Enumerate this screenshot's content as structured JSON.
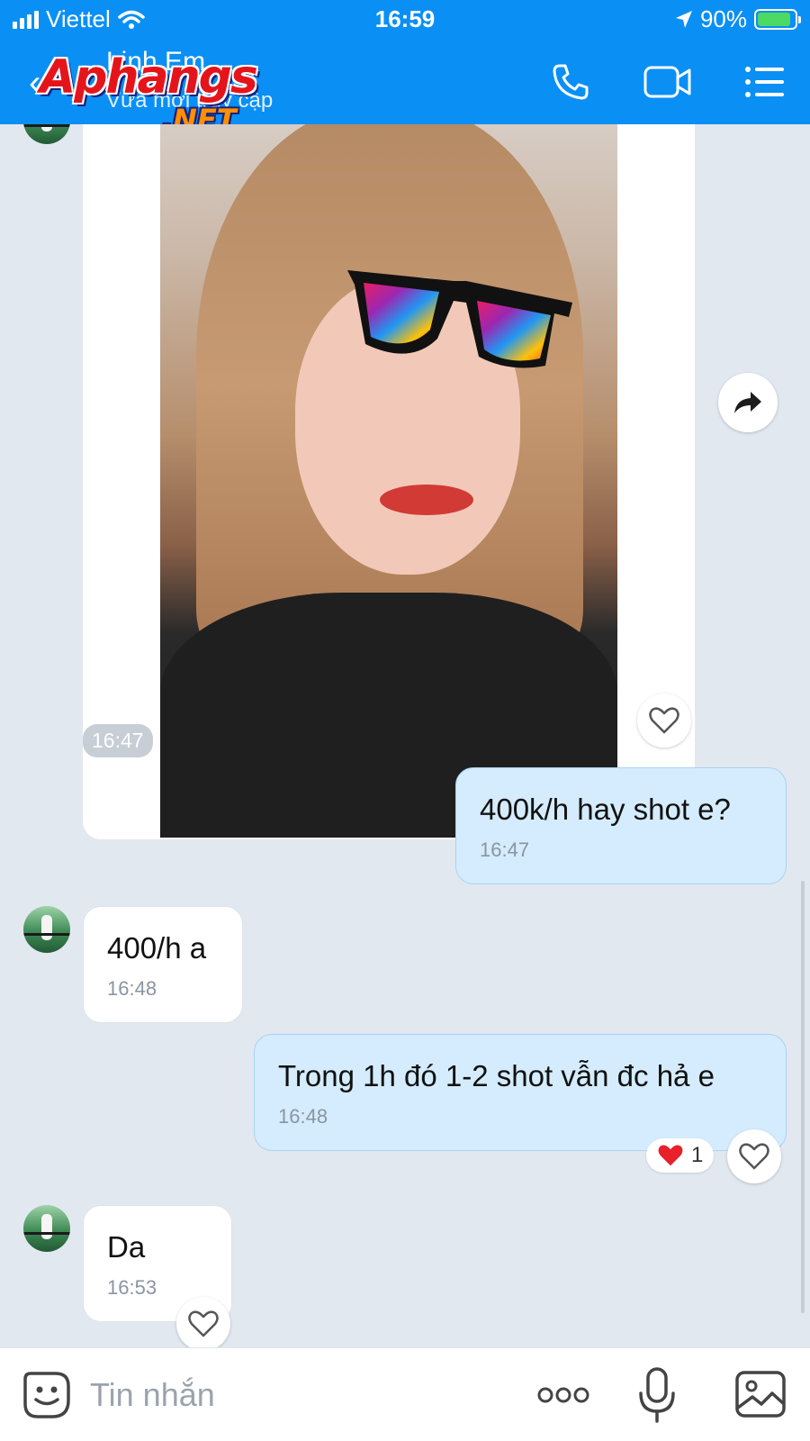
{
  "status_bar": {
    "carrier": "Viettel",
    "time": "16:59",
    "battery": "90%",
    "battery_level": 0.9
  },
  "header": {
    "contact_name": "Linh Em",
    "contact_status": "Vừa mới truy cập",
    "watermark_main": "Aphangs",
    "watermark_sub": ".NET"
  },
  "messages": [
    {
      "side": "in",
      "type": "image",
      "time": "16:47"
    },
    {
      "side": "out",
      "text": "400k/h hay shot e?",
      "time": "16:47"
    },
    {
      "side": "in",
      "text": "400/h a",
      "time": "16:48"
    },
    {
      "side": "out",
      "text": "Trong 1h đó 1-2 shot vẫn đc hả e",
      "time": "16:48",
      "reaction": {
        "emoji": "heart",
        "count": "1"
      }
    },
    {
      "side": "in",
      "text": "Da",
      "time": "16:53"
    }
  ],
  "composer": {
    "placeholder": "Tin nhắn"
  },
  "colors": {
    "header": "#0a8ff5",
    "outgoing_bubble": "#d4ecfd",
    "background": "#e2e8f0"
  }
}
